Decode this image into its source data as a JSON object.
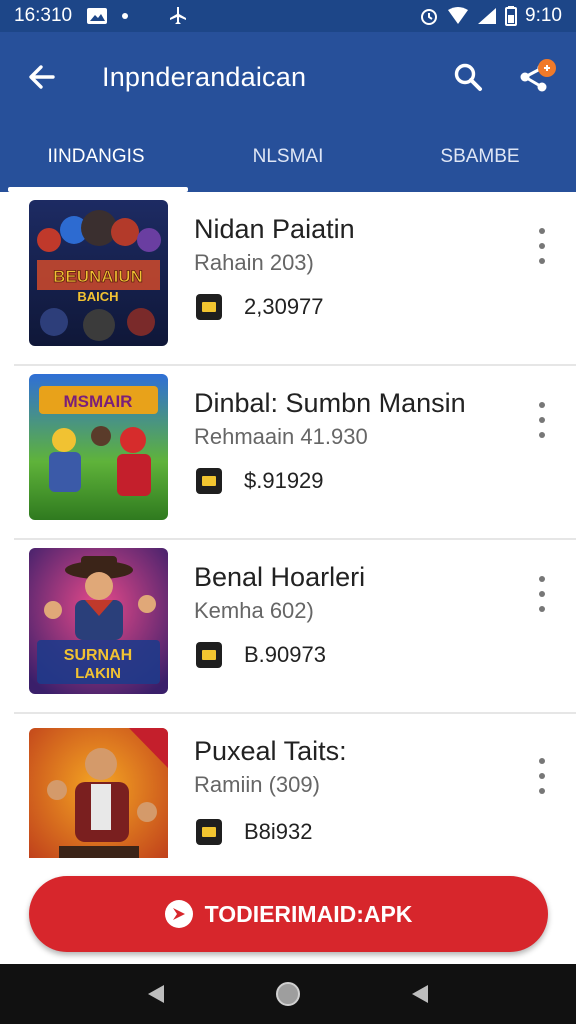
{
  "status_bar": {
    "time_left": "16:310",
    "time_right": "9:10"
  },
  "app_bar": {
    "title": "Inpnderandaican"
  },
  "tabs": [
    {
      "label": "IINDANGIS",
      "active": true
    },
    {
      "label": "NLSMAI",
      "active": false
    },
    {
      "label": "SBAMBE",
      "active": false
    }
  ],
  "items": [
    {
      "title": "Nidan Paiatin",
      "subtitle": "Rahain 203)",
      "value": "2,30977",
      "thumb_text_top": "BEUNAIUN",
      "thumb_text_bottom": "BAICH",
      "thumb_colors": [
        "#1d2b63",
        "#d04a2a",
        "#f1c232"
      ]
    },
    {
      "title": "Dinbal: Sumbn Mansin",
      "subtitle": "Rehmaain 41.930",
      "value": "$.91929",
      "thumb_text_top": "MSMAIR",
      "thumb_text_bottom": "",
      "thumb_colors": [
        "#2f6fd6",
        "#3b9a2c",
        "#d62c2c"
      ]
    },
    {
      "title": "Benal Hoarleri",
      "subtitle": "Kemha 602)",
      "value": "B.90973",
      "thumb_text_top": "SURNAH",
      "thumb_text_bottom": "LAKIN",
      "thumb_colors": [
        "#4a1f7a",
        "#c0392b",
        "#f1c232"
      ]
    },
    {
      "title": "Puxeal Taits:",
      "subtitle": "Ramiin (309)",
      "value": "B8i932",
      "thumb_text_top": "",
      "thumb_text_bottom": "",
      "thumb_colors": [
        "#d9531e",
        "#7a1f1f",
        "#f5a623"
      ]
    }
  ],
  "download_button": {
    "label": "TODIERIMAID:APK"
  },
  "colors": {
    "app_bar": "#27509a",
    "status_bar": "#1d4688",
    "download": "#d7262c"
  }
}
